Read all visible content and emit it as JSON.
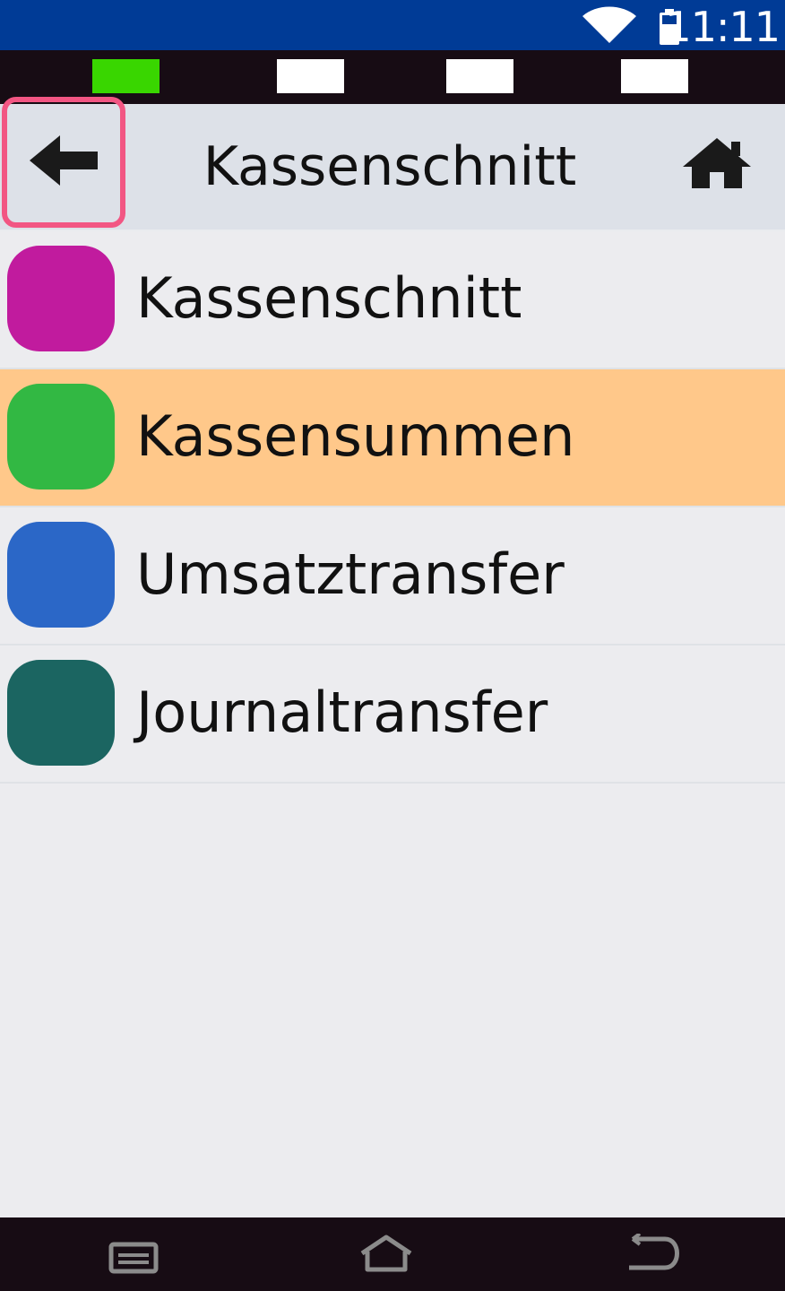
{
  "status_bar": {
    "time": "11:11",
    "icons": [
      "wifi-icon",
      "battery-icon"
    ]
  },
  "indicator_bar": {
    "items": [
      {
        "color": "#39d600"
      },
      {
        "color": "#ffffff"
      },
      {
        "color": "#ffffff"
      },
      {
        "color": "#ffffff"
      }
    ]
  },
  "header": {
    "title": "Kassenschnitt",
    "back_icon": "arrow-left-icon",
    "home_icon": "home-icon",
    "highlight_color": "#f25683"
  },
  "menu": {
    "items": [
      {
        "label": "Kassenschnitt",
        "color": "#c11b9e",
        "selected": false
      },
      {
        "label": "Kassensummen",
        "color": "#32b843",
        "selected": true
      },
      {
        "label": "Umsatztransfer",
        "color": "#2b67c7",
        "selected": false
      },
      {
        "label": "Journaltransfer",
        "color": "#1b6561",
        "selected": false
      }
    ],
    "selected_color": "#ffc88a"
  },
  "nav_bar": {
    "icons": [
      "recent-apps-icon",
      "home-icon",
      "back-icon"
    ]
  }
}
